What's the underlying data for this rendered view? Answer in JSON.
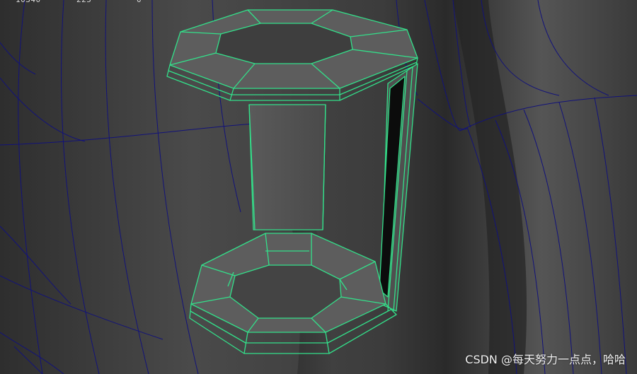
{
  "hud": {
    "stat_1": "10340",
    "stat_2": "225",
    "stat_3": "0"
  },
  "watermark": {
    "text": "CSDN @每天努力一点点，哈哈"
  },
  "colors": {
    "background": "#3b3b3b",
    "background_mesh_wire": "#12127a",
    "selected_wire": "#33e08a"
  }
}
